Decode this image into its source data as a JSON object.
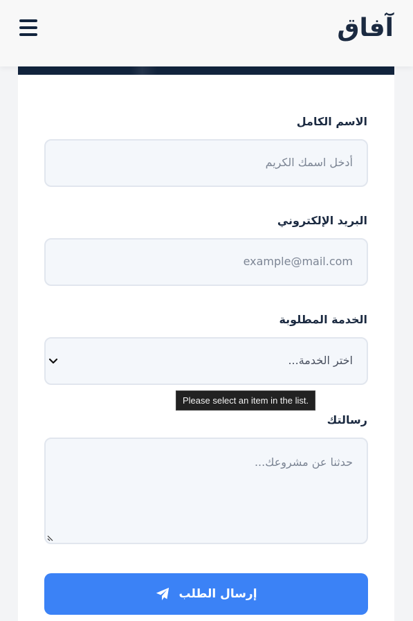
{
  "header": {
    "logo_text": "آفاق",
    "menu_icon": "hamburger-menu-icon"
  },
  "form": {
    "name": {
      "label": "الاسم الكامل",
      "placeholder": "أدخل اسمك الكريم"
    },
    "email": {
      "label": "البريد الإلكتروني",
      "placeholder": "example@mail.com"
    },
    "service": {
      "label": "الخدمة المطلوبة",
      "selected": "اختر الخدمة..."
    },
    "validation_tooltip": "Please select an item in the list.",
    "message": {
      "label": "رسالتك",
      "placeholder": "حدثنا عن مشروعك..."
    },
    "submit_label": "إرسال الطلب",
    "submit_icon": "paper-plane-icon"
  },
  "colors": {
    "brand_dark": "#12243d",
    "accent": "#3b82f6",
    "input_bg": "#f4f7fb"
  }
}
